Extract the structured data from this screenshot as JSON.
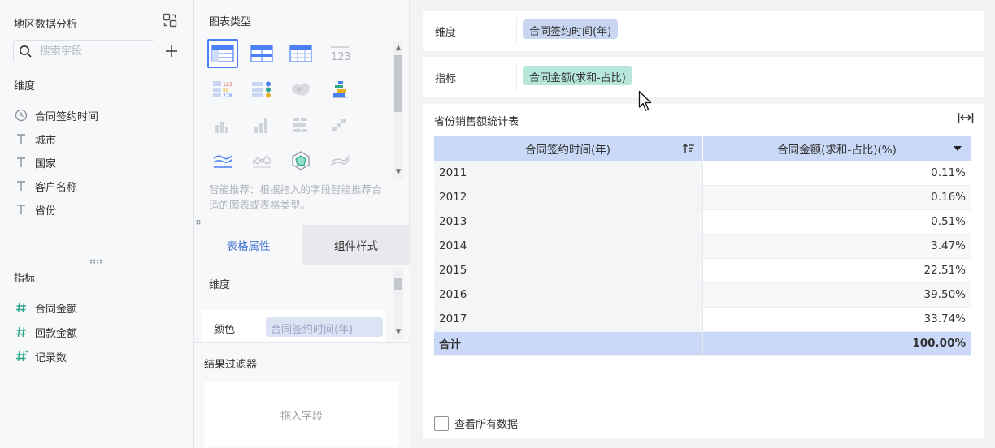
{
  "left": {
    "title": "地区数据分析",
    "search_placeholder": "搜索字段",
    "dimension_label": "维度",
    "dimension_fields": [
      {
        "label": "合同签约时间",
        "icon": "clock-icon"
      },
      {
        "label": "城市",
        "icon": "text-type-icon"
      },
      {
        "label": "国家",
        "icon": "text-type-icon"
      },
      {
        "label": "客户名称",
        "icon": "text-type-icon"
      },
      {
        "label": "省份",
        "icon": "text-type-icon"
      }
    ],
    "metric_label": "指标",
    "metric_fields": [
      {
        "label": "合同金额",
        "icon": "number-type-icon"
      },
      {
        "label": "回款金额",
        "icon": "number-type-icon"
      },
      {
        "label": "记录数",
        "icon": "number-type-icon"
      }
    ]
  },
  "middle": {
    "chart_type_title": "图表类型",
    "hint": "智能推荐：根据拖入的字段智能推荐合适的图表或表格类型。",
    "tabs": {
      "active": "表格属性",
      "inactive": "组件样式"
    },
    "dimension_label": "维度",
    "color_label": "颜色",
    "color_field": "合同签约时间(年)",
    "filter_title": "结果过滤器",
    "filter_drop": "拖入字段"
  },
  "right": {
    "dimension_shelf_label": "维度",
    "dimension_pill": "合同签约时间(年)",
    "metric_shelf_label": "指标",
    "metric_pill": "合同金额(求和-占比)",
    "table_title": "省份销售额统计表",
    "table_headers": [
      "合同签约时间(年)",
      "合同金额(求和-占比)(%)"
    ],
    "rows": [
      {
        "year": "2011",
        "value": "0.11%"
      },
      {
        "year": "2012",
        "value": "0.16%"
      },
      {
        "year": "2013",
        "value": "0.51%"
      },
      {
        "year": "2014",
        "value": "3.47%"
      },
      {
        "year": "2015",
        "value": "22.51%"
      },
      {
        "year": "2016",
        "value": "39.50%"
      },
      {
        "year": "2017",
        "value": "33.74%"
      }
    ],
    "total": {
      "label": "合计",
      "value": "100.00%"
    },
    "view_all_label": "查看所有数据"
  },
  "colors": {
    "accent": "#3f72d1",
    "dimension_pill": "#c9d6f1",
    "metric_pill": "#b7e6db",
    "table_header": "#c9d9f7"
  }
}
